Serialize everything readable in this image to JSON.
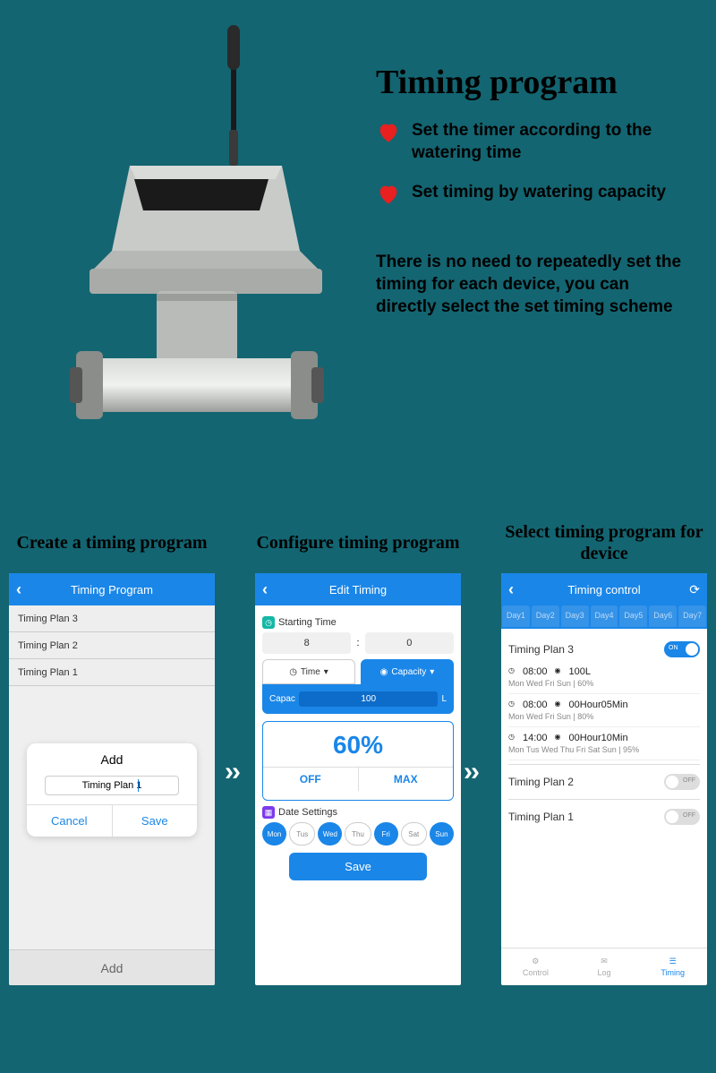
{
  "header": {
    "title": "Timing program",
    "bullet1": "Set the timer according to the watering time",
    "bullet2": "Set timing by watering capacity",
    "desc": "There is no need to repeatedly set the timing for each device, you can directly select the set timing scheme"
  },
  "screenTitles": {
    "s1": "Create a timing program",
    "s2": "Configure timing program",
    "s3": "Select timing program for device"
  },
  "screen1": {
    "nav": "Timing Program",
    "plans": [
      "Timing Plan 3",
      "Timing Plan 2",
      "Timing Plan 1"
    ],
    "modalTitle": "Add",
    "modalInput": "Timing Plan 1",
    "cancel": "Cancel",
    "save": "Save",
    "footerBtn": "Add"
  },
  "screen2": {
    "nav": "Edit Timing",
    "startLabel": "Starting Time",
    "hour": "8",
    "minute": "0",
    "tabTime": "Time",
    "tabCapacity": "Capacity",
    "capLabel": "Capac",
    "capValue": "100",
    "capUnit": "L",
    "gaugeValue": "60%",
    "offBtn": "OFF",
    "maxBtn": "MAX",
    "dateLabel": "Date Settings",
    "days": [
      {
        "label": "Mon",
        "on": true
      },
      {
        "label": "Tus",
        "on": false
      },
      {
        "label": "Wed",
        "on": true
      },
      {
        "label": "Thu",
        "on": false
      },
      {
        "label": "Fri",
        "on": true
      },
      {
        "label": "Sat",
        "on": false
      },
      {
        "label": "Sun",
        "on": true
      }
    ],
    "saveBtn": "Save"
  },
  "screen3": {
    "nav": "Timing control",
    "dayTabs": [
      "Day1",
      "Day2",
      "Day3",
      "Day4",
      "Day5",
      "Day6",
      "Day7"
    ],
    "plan3": {
      "title": "Timing Plan 3",
      "on": true,
      "schedules": [
        {
          "time": "08:00",
          "val": "100L",
          "meta": "Mon  Wed  Fri  Sun  |  60%"
        },
        {
          "time": "08:00",
          "val": "00Hour05Min",
          "meta": "Mon  Wed  Fri  Sun  |  80%"
        },
        {
          "time": "14:00",
          "val": "00Hour10Min",
          "meta": "Mon  Tus  Wed  Thu  Fri  Sat  Sun  |  95%"
        }
      ]
    },
    "plan2": {
      "title": "Timing Plan 2",
      "state": "OFF"
    },
    "plan1": {
      "title": "Timing Plan 1",
      "state": "OFF"
    },
    "nav_control": "Control",
    "nav_log": "Log",
    "nav_timing": "Timing"
  }
}
